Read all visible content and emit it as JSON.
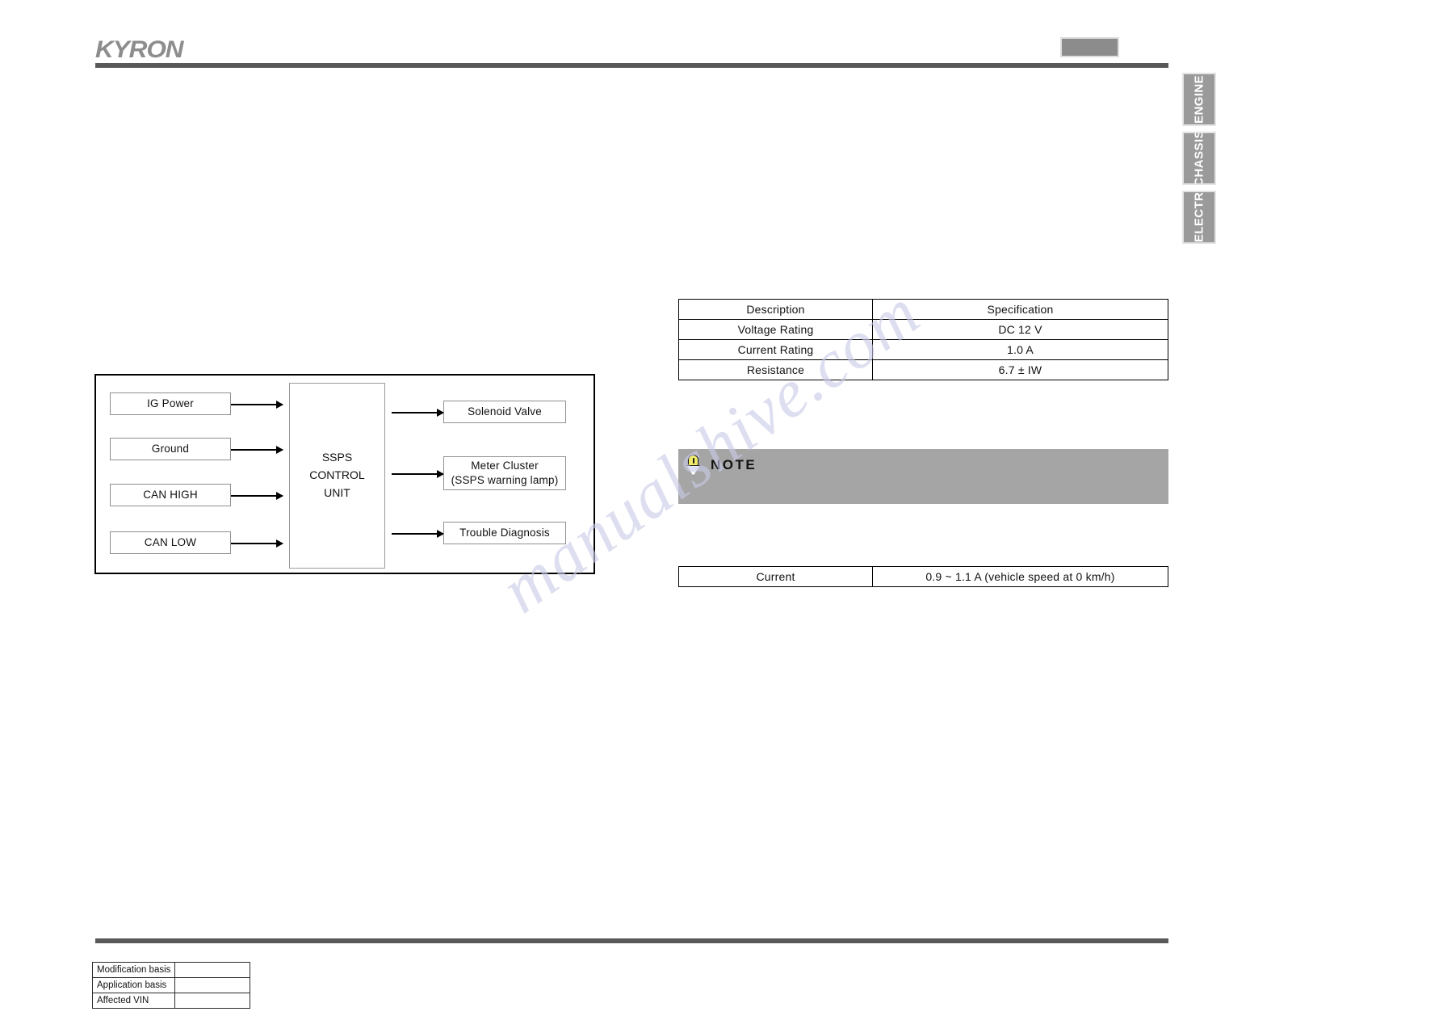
{
  "header": {
    "brand": "KYRON",
    "chip_label": ""
  },
  "side_tabs": [
    {
      "label": "ENGINE"
    },
    {
      "label": "CHASSIS"
    },
    {
      "label": "ELECTRIC"
    }
  ],
  "diagram": {
    "inputs": [
      {
        "label": "IG Power"
      },
      {
        "label": "Ground"
      },
      {
        "label": "CAN HIGH"
      },
      {
        "label": "CAN LOW"
      }
    ],
    "control_unit": "SSPS\nCONTROL\nUNIT",
    "control_unit_line1": "SSPS",
    "control_unit_line2": "CONTROL",
    "control_unit_line3": "UNIT",
    "outputs": [
      {
        "label": "Solenoid Valve",
        "sub": ""
      },
      {
        "label": "Meter Cluster",
        "sub": "(SSPS warning lamp)"
      },
      {
        "label": "Trouble Diagnosis",
        "sub": ""
      }
    ]
  },
  "spec_table": {
    "headers": [
      "Description",
      "Specification"
    ],
    "rows": [
      {
        "description": "Voltage Rating",
        "specification": "DC 12 V"
      },
      {
        "description": "Current Rating",
        "specification": "1.0 A"
      },
      {
        "description": "Resistance",
        "specification": "6.7 ± IW"
      }
    ]
  },
  "note": {
    "label": "NOTE",
    "icon": "lightbulb-icon",
    "body": ""
  },
  "current_table": {
    "rows": [
      {
        "label": "Current",
        "value": "0.9 ~ 1.1 A (vehicle speed at 0 km/h)"
      }
    ]
  },
  "footer_table": {
    "rows": [
      {
        "key": "Modification basis",
        "value": ""
      },
      {
        "key": "Application basis",
        "value": ""
      },
      {
        "key": "Affected VIN",
        "value": ""
      }
    ]
  },
  "watermark": {
    "text": "manualshive.com"
  },
  "colors": {
    "rule": "#595959",
    "tab_bg": "#9a9a9a",
    "note_bg": "#a5a5a5",
    "logo": "#8d8d8d",
    "bulb": "#f0ec6a"
  }
}
